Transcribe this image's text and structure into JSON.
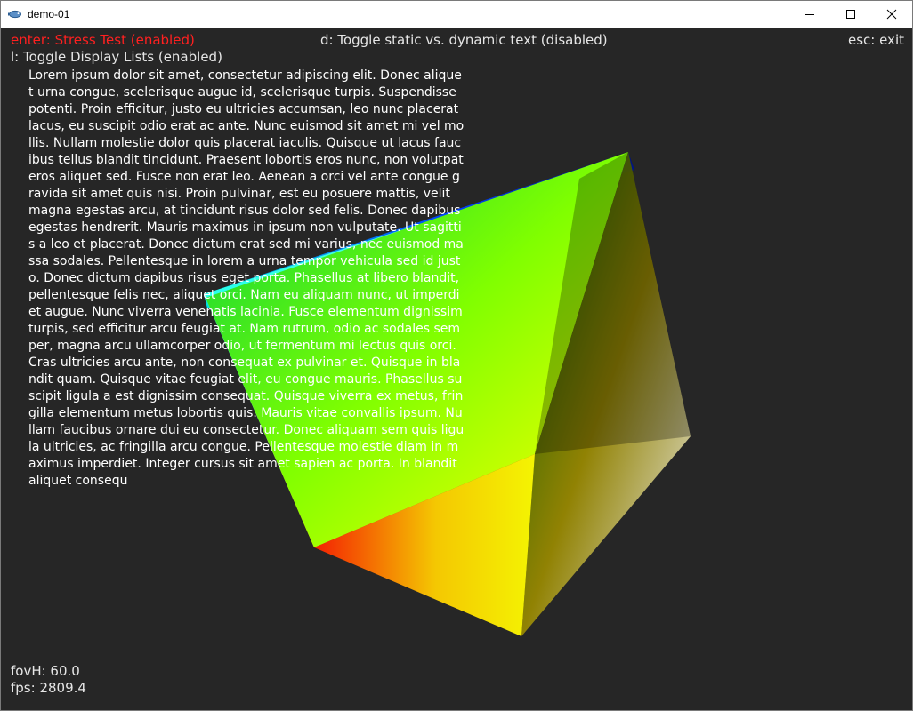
{
  "window": {
    "title": "demo-01",
    "icon": "fish-icon",
    "controls": [
      "minimize-icon",
      "maximize-icon",
      "close-icon"
    ]
  },
  "hud": {
    "stress_test": "enter: Stress Test (enabled)",
    "toggle_text": "d: Toggle static vs. dynamic text (disabled)",
    "exit": "esc: exit",
    "display_lists": "l: Toggle Display Lists (enabled)",
    "fov": "fovH: 60.0",
    "fps": "fps: 2809.4"
  },
  "body_text": "Lorem ipsum dolor sit amet, consectetur adipiscing elit. Donec aliquet urna congue, scelerisque augue id, scelerisque turpis. Suspendisse potenti. Proin efficitur, justo eu ultricies accumsan, leo nunc placerat lacus, eu suscipit odio erat ac ante. Nunc euismod sit amet mi vel mollis. Nullam molestie dolor quis placerat iaculis. Quisque ut lacus faucibus tellus blandit tincidunt. Praesent lobortis eros nunc, non volutpat eros aliquet sed. Fusce non erat leo. Aenean a orci vel ante congue gravida sit amet quis nisi. Proin pulvinar, est eu posuere mattis, velit magna egestas arcu, at tincidunt risus dolor sed felis. Donec dapibus egestas hendrerit. Mauris maximus in ipsum non vulputate. Ut sagittis a leo et placerat. Donec dictum erat sed mi varius, nec euismod massa sodales. Pellentesque in lorem a urna tempor vehicula sed id justo. Donec dictum dapibus risus eget porta. Phasellus at libero blandit, pellentesque felis nec, aliquet orci. Nam eu aliquam nunc, ut imperdiet augue. Nunc viverra venenatis lacinia. Fusce elementum dignissim turpis, sed efficitur arcu feugiat at. Nam rutrum, odio ac sodales semper, magna arcu ullamcorper odio, ut fermentum mi lectus quis orci. Cras ultricies arcu ante, non consequat ex pulvinar et. Quisque in blandit quam. Quisque vitae feugiat elit, eu congue mauris. Phasellus suscipit ligula a est dignissim consequat. Quisque viverra ex metus, fringilla elementum metus lobortis quis. Mauris vitae convallis ipsum. Nullam faucibus ornare dui eu consectetur. Donec aliquam sem quis ligula ultricies, ac fringilla arcu congue. Pellentesque molestie diam in maximus imperdiet. Integer cursus sit amet sapien ac porta. In blandit aliquet consequ",
  "colors": {
    "background": "#262626",
    "hud_text": "#e6e6e6",
    "hud_highlight": "#ff2020",
    "titlebar": "#ffffff"
  }
}
